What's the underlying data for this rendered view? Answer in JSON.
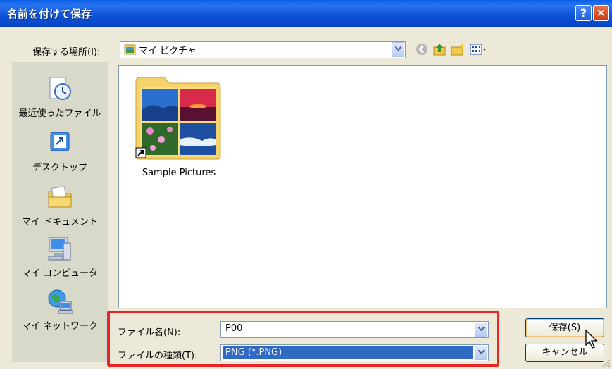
{
  "window": {
    "title": "名前を付けて保存",
    "help_label": "?",
    "close_label": "✕"
  },
  "location": {
    "label": "保存する場所(I):",
    "value": "マイ ピクチャ"
  },
  "toolbar": {
    "icons": [
      "back-icon",
      "up-folder-icon",
      "new-folder-icon",
      "views-menu-icon"
    ]
  },
  "places": [
    {
      "label": "最近使ったファイル",
      "icon": "recent-files-icon"
    },
    {
      "label": "デスクトップ",
      "icon": "desktop-icon"
    },
    {
      "label": "マイ ドキュメント",
      "icon": "my-documents-icon"
    },
    {
      "label": "マイ コンピュータ",
      "icon": "my-computer-icon"
    },
    {
      "label": "マイ ネットワーク",
      "icon": "my-network-icon"
    }
  ],
  "files": [
    {
      "name": "Sample Pictures",
      "icon": "folder-thumbnail-icon"
    }
  ],
  "filename": {
    "label": "ファイル名(N):",
    "value": "P00"
  },
  "filetype": {
    "label": "ファイルの種類(T):",
    "value": "PNG (*.PNG)"
  },
  "buttons": {
    "save": "保存(S)",
    "cancel": "キャンセル"
  },
  "colors": {
    "titlebar": "#0A53D6",
    "highlight": "#E82525",
    "selection": "#316AC5"
  }
}
